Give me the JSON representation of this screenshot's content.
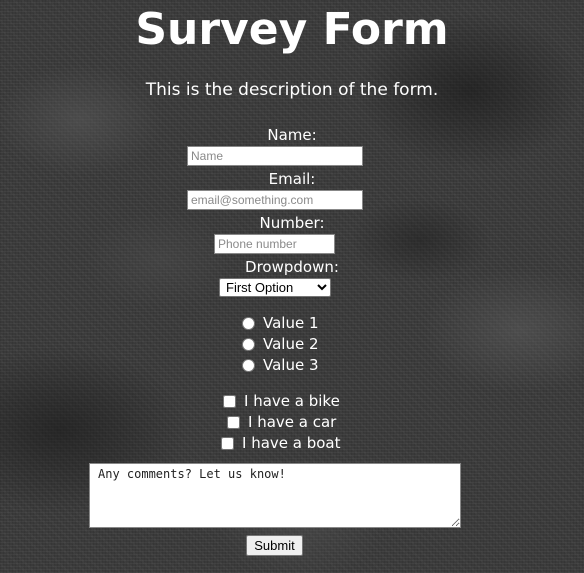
{
  "header": {
    "title": "Survey Form",
    "description": "This is the description of the form."
  },
  "form": {
    "name": {
      "label": "Name:",
      "placeholder": "Name",
      "value": ""
    },
    "email": {
      "label": "Email:",
      "placeholder": "email@something.com",
      "value": ""
    },
    "number": {
      "label": "Number:",
      "placeholder": "Phone number",
      "value": ""
    },
    "dropdown": {
      "label": "Drowpdown:",
      "selected": "First Option"
    },
    "radios": [
      {
        "label": "Value 1",
        "checked": false
      },
      {
        "label": "Value 2",
        "checked": false
      },
      {
        "label": "Value 3",
        "checked": false
      }
    ],
    "checkboxes": [
      {
        "label": "I have a bike",
        "checked": false
      },
      {
        "label": "I have a car",
        "checked": false
      },
      {
        "label": "I have a boat",
        "checked": false
      }
    ],
    "comments": {
      "placeholder": "Any comments? Let us know!",
      "value": ""
    },
    "submit_label": "Submit"
  }
}
